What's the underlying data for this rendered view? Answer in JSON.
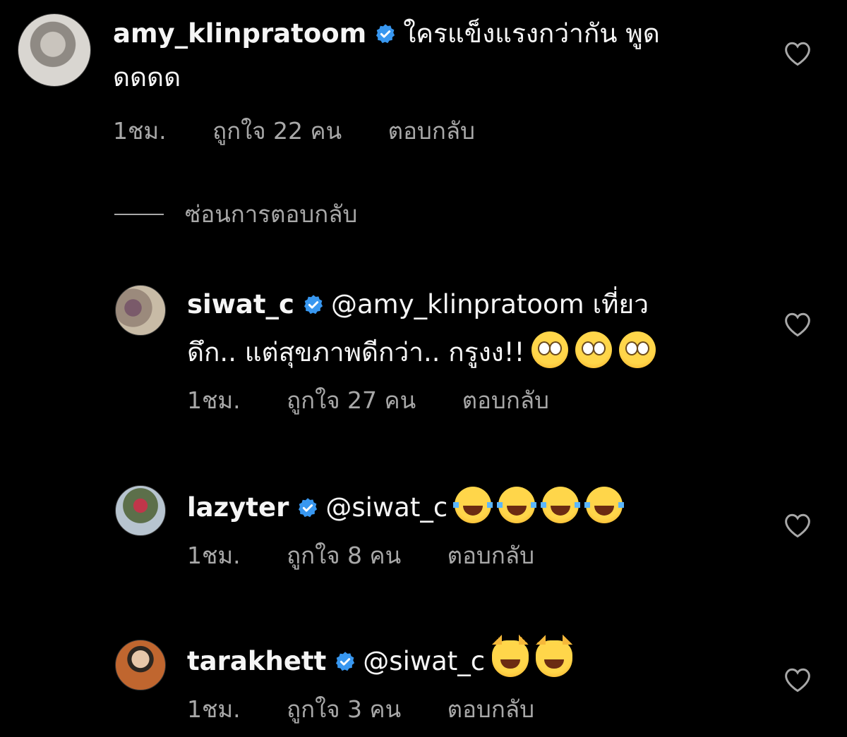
{
  "comments": [
    {
      "username": "amy_klinpratoom",
      "text_line1": "ใครแข็งแรงกว่ากัน พูด",
      "text_line2": "ดดดด",
      "time": "1ชม.",
      "likes": "ถูกใจ 22 คน",
      "reply": "ตอบกลับ"
    },
    {
      "username": "siwat_c",
      "text_line1": "@amy_klinpratoom เที่ยว",
      "text_line2": "ดึก.. แต่สุขภาพดีกว่า.. กรูงง!!",
      "emojis": [
        "face-with-rolling-eyes",
        "face-with-rolling-eyes",
        "face-with-rolling-eyes"
      ],
      "time": "1ชม.",
      "likes": "ถูกใจ 27 คน",
      "reply": "ตอบกลับ"
    },
    {
      "username": "lazyter",
      "text_line1": "@siwat_c",
      "emojis": [
        "face-with-tears-of-joy",
        "face-with-tears-of-joy",
        "face-with-tears-of-joy",
        "face-with-tears-of-joy"
      ],
      "time": "1ชม.",
      "likes": "ถูกใจ 8 คน",
      "reply": "ตอบกลับ"
    },
    {
      "username": "tarakhett",
      "text_line1": "@siwat_c",
      "emojis": [
        "cat-with-tears-of-joy",
        "cat-with-tears-of-joy"
      ],
      "time": "1ชม.",
      "likes": "ถูกใจ 3 คน",
      "reply": "ตอบกลับ"
    }
  ],
  "hide_replies_label": "ซ่อนการตอบกลับ",
  "colors": {
    "background": "#000000",
    "verified": "#3897f0",
    "meta": "#a8a8a8"
  }
}
